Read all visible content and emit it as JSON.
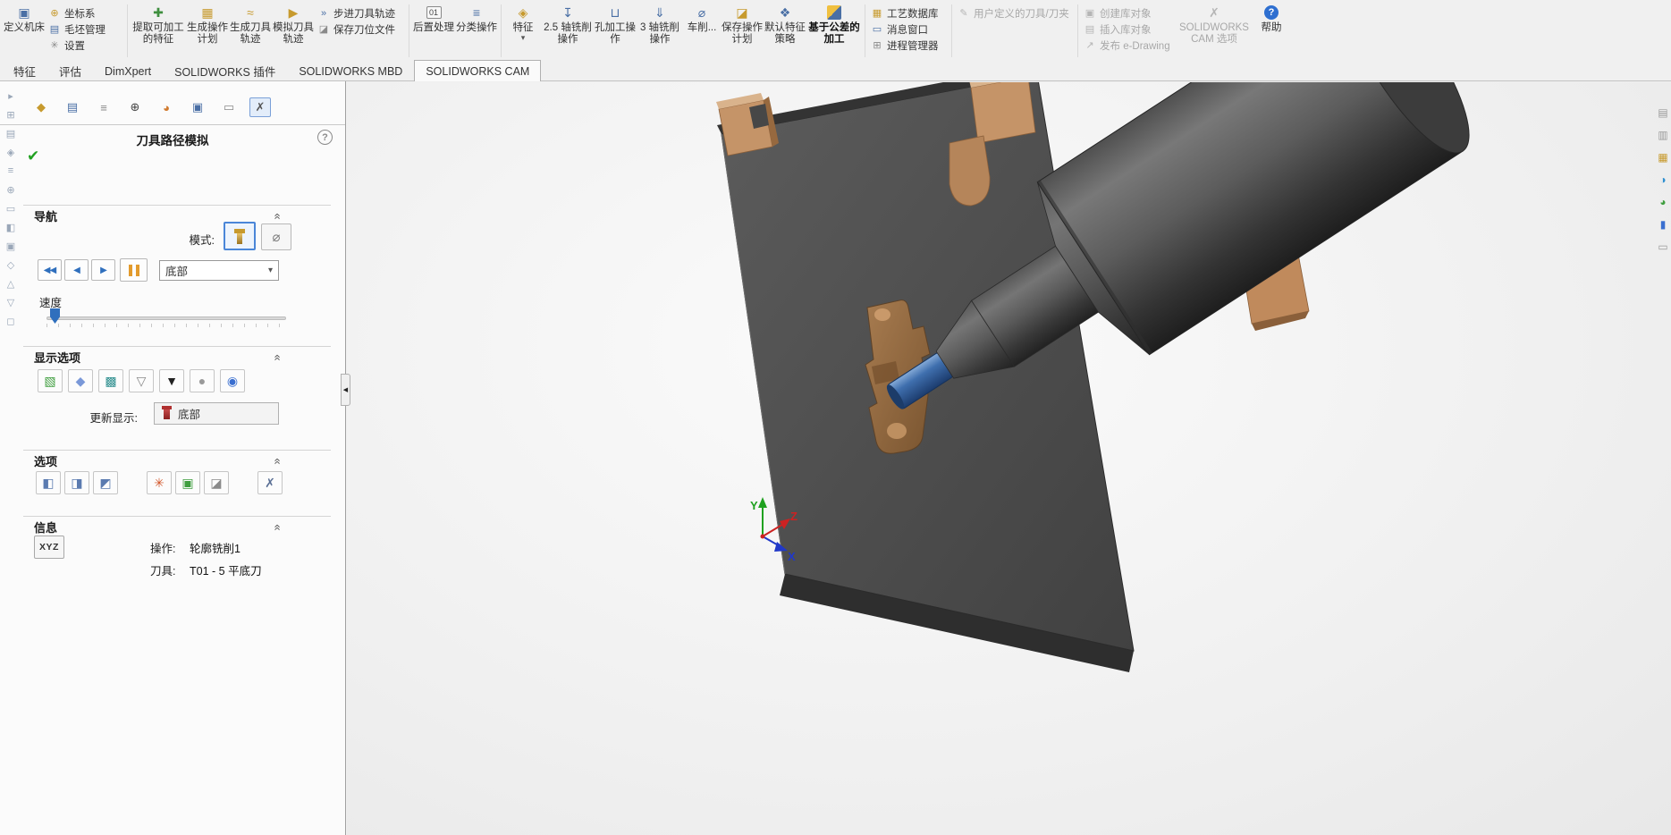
{
  "app": {
    "name": "SOLIDWORKS CAM"
  },
  "ribbon": {
    "define_machine": "定义机床",
    "coord": "坐标系",
    "stock": "毛坯管理",
    "setup": "设置",
    "extract": "提取可加工的特征",
    "gen_plan": "生成操作计划",
    "gen_toolpath": "生成刀具轨迹",
    "simulate": "模拟刀具轨迹",
    "step": "步进刀具轨迹",
    "save_cl": "保存刀位文件",
    "post": "后置处理",
    "sort": "分类操作",
    "feature": "特征",
    "mill25": "2.5 轴铣削操作",
    "hole": "孔加工操作",
    "mill3": "3 轴铣削操作",
    "turn": "车削...",
    "save_plan": "保存操作计划",
    "default_strategy": "默认特征策略",
    "tbm": "基于公差的加工",
    "tech_db": "工艺数据库",
    "msg": "消息窗口",
    "proc": "进程管理器",
    "user_tool": "用户定义的刀具/刀夹",
    "create_lib": "创建库对象",
    "insert_lib": "插入库对象",
    "edrawing": "发布 e-Drawing",
    "cam_options": "SOLIDWORKS CAM 选项",
    "help": "帮助"
  },
  "tabs": [
    "特征",
    "评估",
    "DimXpert",
    "SOLIDWORKS 插件",
    "SOLIDWORKS MBD",
    "SOLIDWORKS CAM"
  ],
  "active_tab": "SOLIDWORKS CAM",
  "panel": {
    "title": "刀具路径模拟",
    "nav": {
      "header": "导航",
      "mode_label": "模式:",
      "position_value": "底部",
      "speed_label": "速度"
    },
    "display": {
      "header": "显示选项",
      "update_label": "更新显示:",
      "update_value": "底部"
    },
    "options": {
      "header": "选项"
    },
    "info": {
      "header": "信息",
      "xyz": "XYZ",
      "operation_label": "操作:",
      "operation_value": "轮廓铣削1",
      "tool_label": "刀具:",
      "tool_value": "T01 - 5 平底刀"
    }
  },
  "viewport": {
    "axes": {
      "x": "X",
      "y": "Y",
      "z": "Z"
    }
  },
  "colors": {
    "accent_blue": "#2f6fbd",
    "selected_border": "#4a86d8",
    "stock_tan": "#c59468",
    "part_gray": "#4a4a4a",
    "tool_blue": "#3f6fae",
    "speed_orange": "#e39b2d",
    "check_green": "#21a121"
  },
  "icons": {
    "define_machine": "▣",
    "coord": "⊕",
    "stock": "▤",
    "setup": "✳",
    "extract": "✚",
    "gen_plan": "▦",
    "gen_toolpath": "≈",
    "simulate": "▶",
    "step": "»",
    "save_cl": "◪",
    "post": "01",
    "sort": "≡",
    "feature": "◈",
    "mill25": "↧",
    "hole": "⊔",
    "mill3": "⇓",
    "turn": "⌀",
    "save_plan": "◪",
    "default_strategy": "❖",
    "tech_db": "▦",
    "msg": "▭",
    "proc": "⊞",
    "user_tool": "✎",
    "create_lib": "▣",
    "insert_lib": "▤",
    "edrawing": "↗",
    "cam_options": "✗",
    "help": "?",
    "pm_tabs": [
      "◆",
      "▤",
      "≡",
      "⊕",
      "◕",
      "▣",
      "▭",
      "✗"
    ],
    "tree": [
      "▸",
      "⊞",
      "▤",
      "◈",
      "≡",
      "⊕",
      "▭",
      "◧",
      "▣",
      "◇",
      "△",
      "▽",
      "◻"
    ],
    "right_strip": [
      "▤",
      "▥",
      "▦",
      "◑",
      "◕",
      "▮",
      "▭"
    ],
    "nav_first": "◀◀",
    "nav_prev": "◀",
    "nav_next": "▶",
    "dropdown_arrow": "▾",
    "turn_mode": "⌀",
    "display_row": [
      "▧",
      "◆",
      "▩",
      "▽",
      "▼",
      "●",
      "◉"
    ],
    "opt_row1": [
      "◧",
      "◨",
      "◩"
    ],
    "opt_row2": [
      "✳",
      "▣",
      "◪"
    ],
    "opt_tools": "✗",
    "collapse": "«",
    "check": "✔",
    "help_circle": "?",
    "panel_arrow": "◀",
    "caret": "▾"
  }
}
